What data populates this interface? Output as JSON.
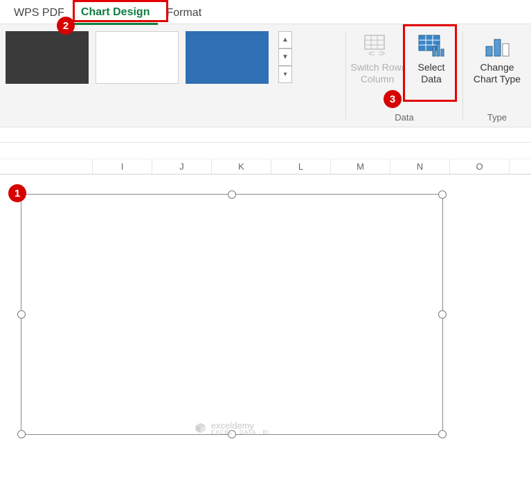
{
  "tabs": {
    "wps": "WPS PDF",
    "chartdesign": "Chart Design",
    "format": "Format"
  },
  "ribbon": {
    "switchrow": {
      "line1": "Switch Row/",
      "line2": "Column"
    },
    "selectdata": {
      "line1": "Select",
      "line2": "Data"
    },
    "changetype": {
      "line1": "Change",
      "line2": "Chart Type"
    },
    "group_data": "Data",
    "group_type": "Type"
  },
  "columns": [
    "I",
    "J",
    "K",
    "L",
    "M",
    "N",
    "O"
  ],
  "watermark": {
    "brand": "exceldemy",
    "tag": "EXCEL · DATA · BI"
  },
  "badges": {
    "one": "1",
    "two": "2",
    "three": "3"
  }
}
